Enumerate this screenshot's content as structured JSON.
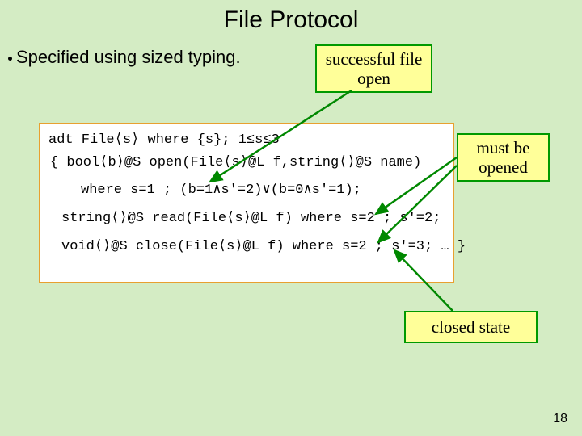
{
  "title": "File Protocol",
  "bullet": "Specified using sized typing.",
  "callouts": {
    "success": "successful file open",
    "must": "must be opened",
    "closed": "closed state"
  },
  "code": {
    "l1": "adt File⟨s⟩ where {s}; 1≤s≤3",
    "l2": "{ bool⟨b⟩@S open(File⟨s⟩@L f,string⟨⟩@S name)",
    "l3": "where s=1 ; (b=1∧s′=2)∨(b=0∧s′=1);",
    "l4": "string⟨⟩@S read(File⟨s⟩@L f) where s=2 ; s′=2;",
    "l5": "void⟨⟩@S close(File⟨s⟩@L f) where s=2 ; s′=3; … }"
  },
  "page": "18"
}
